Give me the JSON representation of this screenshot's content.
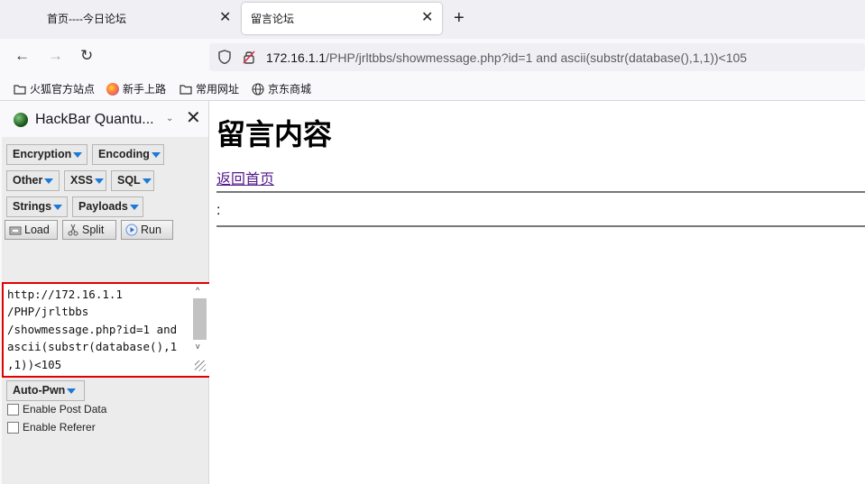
{
  "tabs": [
    {
      "label": "首页----今日论坛"
    },
    {
      "label": "留言论坛"
    }
  ],
  "address_bar": {
    "host": "172.16.1.1",
    "path": "/PHP/jrltbbs/showmessage.php?id=1 and ascii(substr(database(),1,1))<105"
  },
  "bookmarks": [
    {
      "label": "火狐官方站点",
      "icon": "folder-icon"
    },
    {
      "label": "新手上路",
      "icon": "firefox-icon"
    },
    {
      "label": "常用网址",
      "icon": "folder-icon"
    },
    {
      "label": "京东商城",
      "icon": "globe-icon"
    }
  ],
  "sidebar": {
    "title": "HackBar Quantu...",
    "menus": {
      "encryption": "Encryption",
      "encoding": "Encoding",
      "other": "Other",
      "xss": "XSS",
      "sql": "SQL",
      "strings": "Strings",
      "payloads": "Payloads",
      "autopwn": "Auto-Pwn"
    },
    "buttons": {
      "load": "Load",
      "split": "Split",
      "run": "Run"
    },
    "url_value": "http://172.16.1.1\n/PHP/jrltbbs\n/showmessage.php?id=1 and\nascii(substr(database(),1\n,1))<105",
    "checkboxes": {
      "post": "Enable Post Data",
      "referer": "Enable Referer"
    }
  },
  "page": {
    "heading": "留言内容",
    "back_link": "返回首页",
    "content": ":"
  },
  "colors": {
    "highlight_border": "#e00000",
    "link": "#551a8b",
    "dropdown_arrow": "#1a7ad6"
  }
}
